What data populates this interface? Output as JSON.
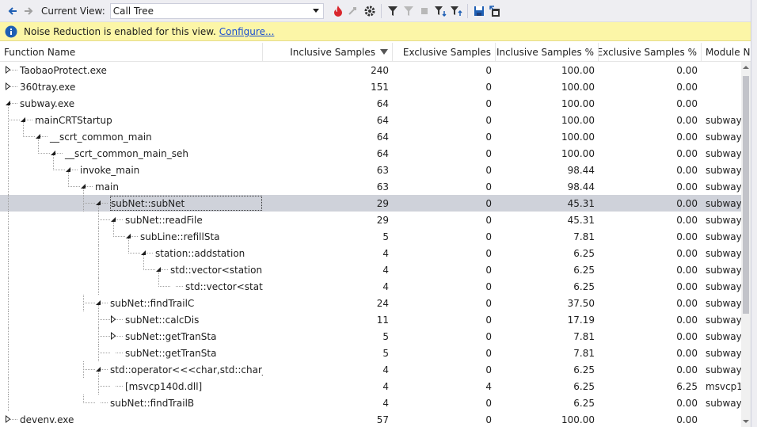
{
  "toolbar": {
    "current_view_label": "Current View:",
    "current_view_value": "Call Tree",
    "icons": [
      "back-arrow-icon",
      "forward-arrow-icon",
      "flame-icon",
      "expand-hot-path-icon",
      "settings-gear-icon",
      "filter-icon",
      "filter-off-icon",
      "stop-icon",
      "filter-down-icon",
      "filter-up-icon",
      "save-icon",
      "export-icon"
    ]
  },
  "infobar": {
    "message": "Noise Reduction is enabled for this view.",
    "link": "Configure..."
  },
  "table": {
    "headers": [
      "Function Name",
      "Inclusive Samples",
      "Exclusive Samples",
      "Inclusive Samples %",
      "Exclusive Samples %",
      "Module N"
    ],
    "rows": [
      {
        "name": "TaobaoProtect.exe",
        "inc": "240",
        "exc": "0",
        "incp": "100.00",
        "excp": "0.00",
        "mod": ""
      },
      {
        "name": "360tray.exe",
        "inc": "151",
        "exc": "0",
        "incp": "100.00",
        "excp": "0.00",
        "mod": ""
      },
      {
        "name": "subway.exe",
        "inc": "64",
        "exc": "0",
        "incp": "100.00",
        "excp": "0.00",
        "mod": ""
      },
      {
        "name": "mainCRTStartup",
        "inc": "64",
        "exc": "0",
        "incp": "100.00",
        "excp": "0.00",
        "mod": "subway"
      },
      {
        "name": "__scrt_common_main",
        "inc": "64",
        "exc": "0",
        "incp": "100.00",
        "excp": "0.00",
        "mod": "subway"
      },
      {
        "name": "__scrt_common_main_seh",
        "inc": "64",
        "exc": "0",
        "incp": "100.00",
        "excp": "0.00",
        "mod": "subway"
      },
      {
        "name": "invoke_main",
        "inc": "63",
        "exc": "0",
        "incp": "98.44",
        "excp": "0.00",
        "mod": "subway"
      },
      {
        "name": "main",
        "inc": "63",
        "exc": "0",
        "incp": "98.44",
        "excp": "0.00",
        "mod": "subway"
      },
      {
        "name": "subNet::subNet",
        "inc": "29",
        "exc": "0",
        "incp": "45.31",
        "excp": "0.00",
        "mod": "subway"
      },
      {
        "name": "subNet::readFile",
        "inc": "29",
        "exc": "0",
        "incp": "45.31",
        "excp": "0.00",
        "mod": "subway"
      },
      {
        "name": "subLine::refillSta",
        "inc": "5",
        "exc": "0",
        "incp": "7.81",
        "excp": "0.00",
        "mod": "subway"
      },
      {
        "name": "station::addstation",
        "inc": "4",
        "exc": "0",
        "incp": "6.25",
        "excp": "0.00",
        "mod": "subway"
      },
      {
        "name": "std::vector<station *",
        "inc": "4",
        "exc": "0",
        "incp": "6.25",
        "excp": "0.00",
        "mod": "subway"
      },
      {
        "name": "std::vector<static",
        "inc": "4",
        "exc": "0",
        "incp": "6.25",
        "excp": "0.00",
        "mod": "subway"
      },
      {
        "name": "subNet::findTrailC",
        "inc": "24",
        "exc": "0",
        "incp": "37.50",
        "excp": "0.00",
        "mod": "subway"
      },
      {
        "name": "subNet::calcDis",
        "inc": "11",
        "exc": "0",
        "incp": "17.19",
        "excp": "0.00",
        "mod": "subway"
      },
      {
        "name": "subNet::getTranSta",
        "inc": "5",
        "exc": "0",
        "incp": "7.81",
        "excp": "0.00",
        "mod": "subway"
      },
      {
        "name": "subNet::getTranSta",
        "inc": "5",
        "exc": "0",
        "incp": "7.81",
        "excp": "0.00",
        "mod": "subway"
      },
      {
        "name": "std::operator<<<char,std::char_tr",
        "inc": "4",
        "exc": "0",
        "incp": "6.25",
        "excp": "0.00",
        "mod": "subway"
      },
      {
        "name": "[msvcp140d.dll]",
        "inc": "4",
        "exc": "4",
        "incp": "6.25",
        "excp": "6.25",
        "mod": "msvcp1"
      },
      {
        "name": "subNet::findTrailB",
        "inc": "4",
        "exc": "0",
        "incp": "6.25",
        "excp": "0.00",
        "mod": "subway"
      },
      {
        "name": "devenv.exe",
        "inc": "57",
        "exc": "0",
        "incp": "100.00",
        "excp": "0.00",
        "mod": ""
      }
    ]
  },
  "colors": {
    "toolbar_bg": "#eeeef2",
    "infobar_bg": "#fcf6a7",
    "link": "#1a4ed1",
    "selected_row": "#cfd2da",
    "accent_blue": "#1e5fb4",
    "flame_red": "#d9262c"
  }
}
